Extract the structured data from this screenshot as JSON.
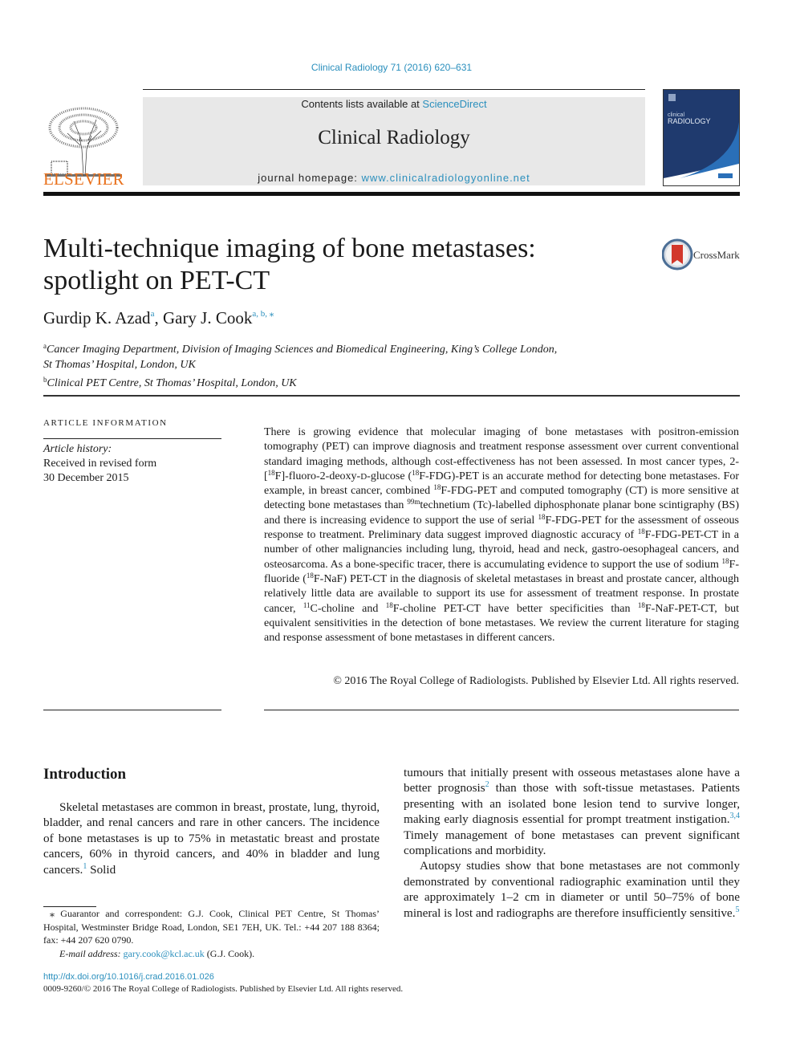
{
  "header": {
    "citation": "Clinical Radiology 71 (2016) 620–631",
    "contents_prefix": "Contents lists available at ",
    "contents_link": "ScienceDirect",
    "journal_name": "Clinical Radiology",
    "homepage_prefix": "journal homepage: ",
    "homepage_link": "www.clinicalradiologyonline.net",
    "publisher_logo_text": "ELSEVIER",
    "cover_title_top": "clinical",
    "cover_title_bottom": "RADIOLOGY",
    "colors": {
      "link": "#2a8fbd",
      "elsevier_orange": "#e9711c",
      "cover_navy": "#1f3a6e",
      "cover_blue": "#2a6fb8"
    }
  },
  "article": {
    "title_line1": "Multi-technique imaging of bone metastases:",
    "title_line2": "spotlight on PET-CT",
    "crossmark_label": "CrossMark",
    "authors": [
      {
        "name": "Gurdip K. Azad",
        "marks": "a"
      },
      {
        "name": "Gary J. Cook",
        "marks": "a, b, ⁎"
      }
    ],
    "affiliations": [
      {
        "mark": "a",
        "text_line1": "Cancer Imaging Department, Division of Imaging Sciences and Biomedical Engineering, King’s College London,",
        "text_line2": "St Thomas’ Hospital, London, UK"
      },
      {
        "mark": "b",
        "text_line1": "Clinical PET Centre, St Thomas’ Hospital, London, UK"
      }
    ]
  },
  "article_info": {
    "heading": "ARTICLE INFORMATION",
    "history_label": "Article history:",
    "received_label": "Received in revised form",
    "received_date": "30 December 2015"
  },
  "abstract": {
    "p1": "There is growing evidence that molecular imaging of bone metastases with positron-emission tomography (PET) can improve diagnosis and treatment response assessment over current conventional standard imaging methods, although cost-effectiveness has not been assessed. In most cancer types, 2-[",
    "sup18": "18",
    "sup99m": "99m",
    "sup11": "11",
    "t1": "F]-fluoro-2-deoxy-",
    "t1d": "D",
    "t2": "-glucose (",
    "t3": "F-FDG)-PET is an accurate method for detecting bone metastases. For example, in breast cancer, combined ",
    "t4": "F-FDG-PET and computed tomography (CT) is more sensitive at detecting bone metastases than ",
    "t5": "technetium (Tc)-labelled diphosphonate planar bone scintigraphy (BS) and there is increasing evidence to support the use of serial ",
    "t6": "F-FDG-PET for the assessment of osseous response to treatment. Preliminary data suggest improved diagnostic accuracy of ",
    "t7": "F-FDG-PET-CT in a number of other malignancies including lung, thyroid, head and neck, gastro-oesophageal cancers, and osteosarcoma. As a bone-specific tracer, there is accumulating evidence to support the use of sodium ",
    "t8": "F-fluoride (",
    "t9": "F-NaF) PET-CT in the diagnosis of skeletal metastases in breast and prostate cancer, although relatively little data are available to support its use for assessment of treatment response. In prostate cancer, ",
    "t10": "C-choline and ",
    "t11": "F-choline PET-CT have better specificities than ",
    "t12": "F-NaF-PET-CT, but equivalent sensitivities in the detection of bone metastases. We review the current literature for staging and response assessment of bone metastases in different cancers.",
    "copyright": "© 2016 The Royal College of Radiologists. Published by Elsevier Ltd. All rights reserved."
  },
  "introduction": {
    "heading": "Introduction",
    "p1a": "Skeletal metastases are common in breast, prostate, lung, thyroid, bladder, and renal cancers and rare in other cancers. The incidence of bone metastases is up to 75% in metastatic breast and prostate cancers, 60% in thyroid cancers, and 40% in bladder and lung cancers.",
    "ref1": "1",
    "p1b": " Solid",
    "p2a": "tumours that initially present with osseous metastases alone have a better prognosis",
    "ref2": "2",
    "p2b": " than those with soft-tissue metastases. Patients presenting with an isolated bone lesion tend to survive longer, making early diagnosis essential for prompt treatment instigation.",
    "ref34": "3,4",
    "p2c": " Timely management of bone metastases can prevent significant complications and morbidity.",
    "p3a": "Autopsy studies show that bone metastases are not commonly demonstrated by conventional radiographic examination until they are approximately 1–2 cm in diameter or until 50–75% of bone mineral is lost and radiographs are therefore insufficiently sensitive.",
    "ref5": "5"
  },
  "footnote": {
    "mark": "⁎",
    "text": " Guarantor and correspondent: G.J. Cook, Clinical PET Centre, St Thomas’ Hospital, Westminster Bridge Road, London, SE1 7EH, UK. Tel.: +44 207 188 8364; fax: +44 207 620 0790.",
    "email_label": "E-mail address: ",
    "email": "gary.cook@kcl.ac.uk",
    "email_suffix": " (G.J. Cook)."
  },
  "footer": {
    "doi": "http://dx.doi.org/10.1016/j.crad.2016.01.026",
    "issn_line": "0009-9260/© 2016 The Royal College of Radiologists. Published by Elsevier Ltd. All rights reserved."
  }
}
